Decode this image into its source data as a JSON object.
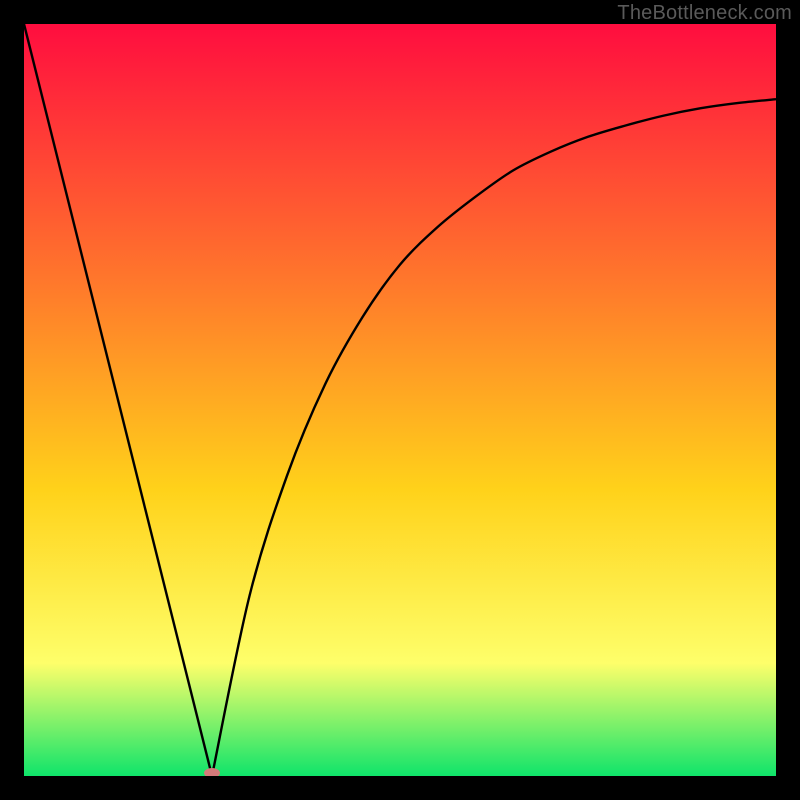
{
  "watermark": "TheBottleneck.com",
  "chart_data": {
    "type": "line",
    "title": "",
    "xlabel": "",
    "ylabel": "",
    "xlim": [
      0,
      100
    ],
    "ylim": [
      0,
      100
    ],
    "grid": false,
    "legend": false,
    "background_gradient": {
      "top": "#ff0d3f",
      "mid1": "#ff7a2b",
      "mid2": "#ffd21a",
      "mid3": "#feff6a",
      "bottom": "#0fe46a"
    },
    "series": [
      {
        "name": "left-limb",
        "x": [
          0,
          25
        ],
        "y": [
          100,
          0
        ],
        "stroke": "#000",
        "note": "straight line from top-left to trough"
      },
      {
        "name": "right-limb",
        "x": [
          25,
          30,
          35,
          40,
          45,
          50,
          55,
          60,
          65,
          70,
          75,
          80,
          85,
          90,
          95,
          100
        ],
        "y": [
          0,
          24,
          40,
          52,
          61,
          68,
          73,
          77,
          80.5,
          83,
          85,
          86.5,
          87.8,
          88.8,
          89.5,
          90
        ],
        "stroke": "#000",
        "note": "curve rising from trough asymptotically toward ~90"
      }
    ],
    "trough_marker": {
      "x": 25,
      "y": 0,
      "color": "#d47a7a",
      "rx": 8,
      "ry": 5
    },
    "axes_visible": false,
    "frame_color": "#000",
    "frame_thickness_px": 24
  }
}
